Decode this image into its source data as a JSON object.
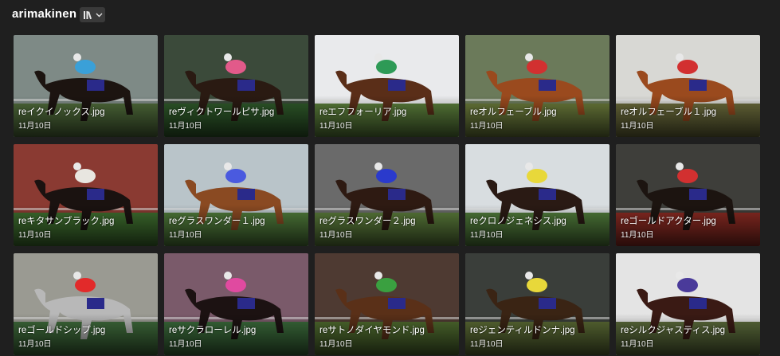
{
  "header": {
    "title": "arimakinen",
    "view_icon": "library-view-icon",
    "dropdown_icon": "chevron-down-icon"
  },
  "files": [
    {
      "name": "reイクイノックス.jpg",
      "date": "11月10日",
      "sky": "#7e8a86",
      "ground": "#4f6b3a",
      "horse": "#1c1410",
      "silk": "#3aa0d8"
    },
    {
      "name": "reヴィクトワールピサ.jpg",
      "date": "11月10日",
      "sky": "#3b4a3a",
      "ground": "#2f5a2a",
      "horse": "#2a1a12",
      "silk": "#e25a8a"
    },
    {
      "name": "reエフフォーリア.jpg",
      "date": "11月10日",
      "sky": "#e9eaec",
      "ground": "#5a7d3a",
      "horse": "#5a2e18",
      "silk": "#2e9a56"
    },
    {
      "name": "reオルフェーブル.jpg",
      "date": "11月10日",
      "sky": "#6b7a5a",
      "ground": "#6a7a3a",
      "horse": "#9a4a1e",
      "silk": "#d23030"
    },
    {
      "name": "reオルフェーブル１.jpg",
      "date": "11月10日",
      "sky": "#d8d8d4",
      "ground": "#6a6a3a",
      "horse": "#9a4a1e",
      "silk": "#d23030"
    },
    {
      "name": "reキタサンブラック.jpg",
      "date": "11月10日",
      "sky": "#8a3a32",
      "ground": "#3e6e2e",
      "horse": "#1a1210",
      "silk": "#e8e6e0"
    },
    {
      "name": "reグラスワンダー１.jpg",
      "date": "11月10日",
      "sky": "#b9c4c9",
      "ground": "#4f7a3a",
      "horse": "#8a4a22",
      "silk": "#4a5adf"
    },
    {
      "name": "reグラスワンダー２.jpg",
      "date": "11月10日",
      "sky": "#6a6a6a",
      "ground": "#5a7a3a",
      "horse": "#2e1a12",
      "silk": "#2a3acc"
    },
    {
      "name": "reクロノジェネシス.jpg",
      "date": "11月10日",
      "sky": "#d8dde0",
      "ground": "#4f7a3a",
      "horse": "#2a1a14",
      "silk": "#e8d83a"
    },
    {
      "name": "reゴールドアクター.jpg",
      "date": "11月10日",
      "sky": "#3e3e3a",
      "ground": "#8a2a22",
      "horse": "#1c1410",
      "silk": "#d23030"
    },
    {
      "name": "reゴールドシップ.jpg",
      "date": "11月10日",
      "sky": "#9a9a92",
      "ground": "#3e6a3a",
      "horse": "#b8b8b8",
      "silk": "#e22a2a"
    },
    {
      "name": "reサクラローレル.jpg",
      "date": "11月10日",
      "sky": "#7a5a6a",
      "ground": "#3a6a3a",
      "horse": "#1c1212",
      "silk": "#e04aa0"
    },
    {
      "name": "reサトノダイヤモンド.jpg",
      "date": "11月10日",
      "sky": "#4e3a32",
      "ground": "#4e6a2e",
      "horse": "#5a3018",
      "silk": "#3aa040"
    },
    {
      "name": "reジェンティルドンナ.jpg",
      "date": "11月10日",
      "sky": "#3a3e3a",
      "ground": "#5a6a34",
      "horse": "#3a2414",
      "silk": "#e8d83a"
    },
    {
      "name": "reシルクジャスティス.jpg",
      "date": "11月10日",
      "sky": "#e4e4e4",
      "ground": "#5a6a3a",
      "horse": "#3a1a14",
      "silk": "#4a3a9a"
    }
  ]
}
